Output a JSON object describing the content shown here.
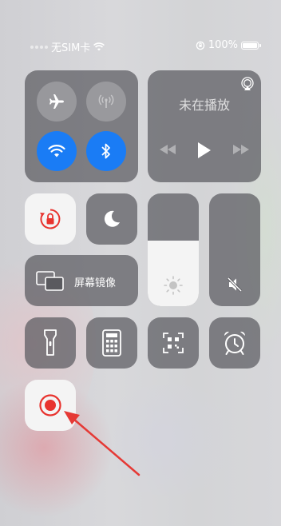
{
  "status_bar": {
    "carrier": "无SIM卡",
    "battery_percent": "100%",
    "battery_level": 1.0,
    "icons": [
      "wifi-icon",
      "orientation-lock-icon",
      "battery-icon"
    ]
  },
  "connectivity": {
    "airplane": {
      "on": false,
      "icon": "airplane-icon"
    },
    "cellular": {
      "on": false,
      "icon": "cellular-antenna-icon"
    },
    "wifi": {
      "on": true,
      "icon": "wifi-icon"
    },
    "bluetooth": {
      "on": true,
      "icon": "bluetooth-icon"
    }
  },
  "music": {
    "title": "未在播放",
    "icons": [
      "airplay-icon",
      "rewind-icon",
      "play-icon",
      "fast-forward-icon"
    ]
  },
  "orientation_lock": {
    "on": true,
    "icon": "orientation-lock-icon"
  },
  "do_not_disturb": {
    "on": false,
    "icon": "moon-icon"
  },
  "screen_mirroring": {
    "label": "屏幕镜像",
    "icon": "screen-mirroring-icon"
  },
  "brightness": {
    "level": 0.58,
    "icon": "sun-icon"
  },
  "volume": {
    "level": 0.0,
    "icon": "speaker-muted-icon"
  },
  "shortcuts": [
    {
      "name": "flashlight",
      "icon": "flashlight-icon"
    },
    {
      "name": "calculator",
      "icon": "calculator-icon"
    },
    {
      "name": "qr-scanner",
      "icon": "qr-code-scanner-icon"
    },
    {
      "name": "alarm",
      "icon": "alarm-clock-icon"
    }
  ],
  "screen_recording": {
    "icon": "record-icon",
    "color": "#e8332e"
  },
  "colors": {
    "accent_blue": "#1a7cf5",
    "record_red": "#e8332e",
    "annotation_arrow": "#e53935"
  }
}
